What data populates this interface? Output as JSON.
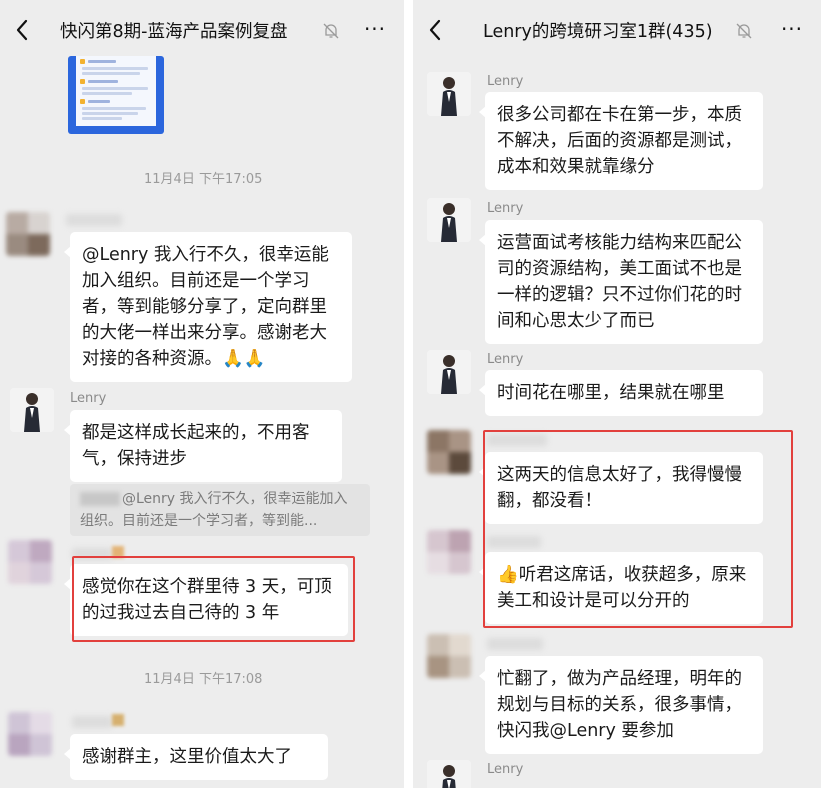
{
  "left": {
    "header": {
      "title": "快闪第8期-蓝海产品案例复盘",
      "more_label": "···"
    },
    "times": [
      "11月4日 下午17:05",
      "11月4日 下午17:08"
    ],
    "messages": [
      {
        "text": "@Lenry 我入行不久，很幸运能加入组织。目前还是一个学习者，等到能够分享了，定向群里的大佬一样出来分享。感谢老大对接的各种资源。🙏🙏"
      },
      {
        "sender": "Lenry",
        "text": "都是这样成长起来的，不用客气，保持进步",
        "quote": "@Lenry 我入行不久，很幸运能加入组织。目前还是一个学习者，等到能..."
      },
      {
        "text": "感觉你在这个群里待 3 天，可顶的过我过去自己待的 3 年"
      },
      {
        "text": "感谢群主，这里价值太大了"
      }
    ]
  },
  "right": {
    "header": {
      "title": "Lenry的跨境研习室1群(435)",
      "more_label": "···"
    },
    "messages": [
      {
        "sender": "Lenry",
        "text": "很多公司都在卡在第一步，本质不解决，后面的资源都是测试，成本和效果就靠缘分"
      },
      {
        "sender": "Lenry",
        "text": "运营面试考核能力结构来匹配公司的资源结构，美工面试不也是一样的逻辑？只不过你们花的时间和心思太少了而已"
      },
      {
        "sender": "Lenry",
        "text": "时间花在哪里，结果就在哪里"
      },
      {
        "text": "这两天的信息太好了，我得慢慢翻，都没看！"
      },
      {
        "text": "👍听君这席话，收获超多，原来美工和设计是可以分开的"
      },
      {
        "text": "忙翻了，做为产品经理，明年的规划与目标的关系，很多事情，快闪我@Lenry 要参加"
      },
      {
        "sender": "Lenry"
      }
    ]
  },
  "colors": {
    "background": "#ededed",
    "bubble": "#ffffff",
    "highlight_box": "#e2403d",
    "card": "#2b66dd"
  },
  "icons": [
    "back-chevron-icon",
    "mute-bell-icon",
    "more-dots-icon"
  ]
}
